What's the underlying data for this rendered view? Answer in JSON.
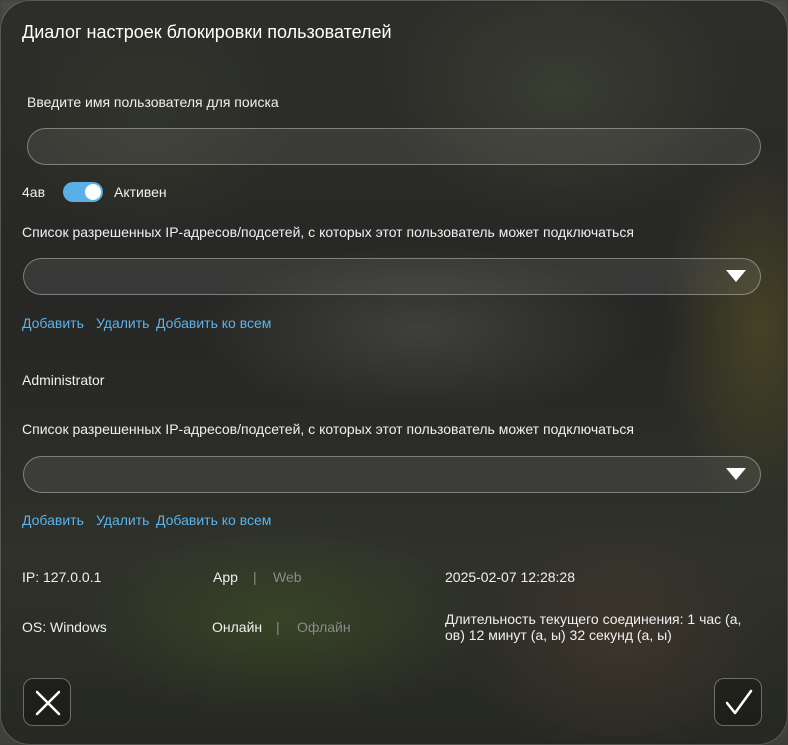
{
  "dialog": {
    "title": "Диалог настроек блокировки пользователей"
  },
  "search": {
    "label": "Введите имя пользователя для поиска",
    "value": "",
    "placeholder": ""
  },
  "user1": {
    "name": "4ав",
    "status_label": "Активен",
    "status_active": true,
    "ip_list_label": "Список разрешенных IP-адресов/подсетей, с которых этот пользователь может подключаться",
    "ip_selected": "",
    "actions": {
      "add": "Добавить",
      "remove": "Удалить",
      "add_all": "Добавить ко всем"
    }
  },
  "user2": {
    "name": "Administrator",
    "ip_list_label": "Список разрешенных IP-адресов/подсетей, с которых этот пользователь может подключаться",
    "ip_selected": "",
    "actions": {
      "add": "Добавить",
      "remove": "Удалить",
      "add_all": "Добавить ко всем"
    }
  },
  "session": {
    "ip": "IP: 127.0.0.1",
    "client_app": "App",
    "separator": "|",
    "client_web": "Web",
    "timestamp": "2025-02-07 12:28:28",
    "os": "OS: Windows",
    "online": "Онлайн",
    "offline": "Офлайн",
    "duration": "Длительность текущего соединения: 1 час (а, ов) 12 минут (а, ы) 32 секунд (а, ы)"
  },
  "buttons": {
    "cancel_icon": "close-icon",
    "confirm_icon": "checkmark-icon"
  },
  "colors": {
    "accent": "#5bb4ea",
    "toggle_on": "#5ab0e6",
    "muted": "#8a8a8a"
  }
}
